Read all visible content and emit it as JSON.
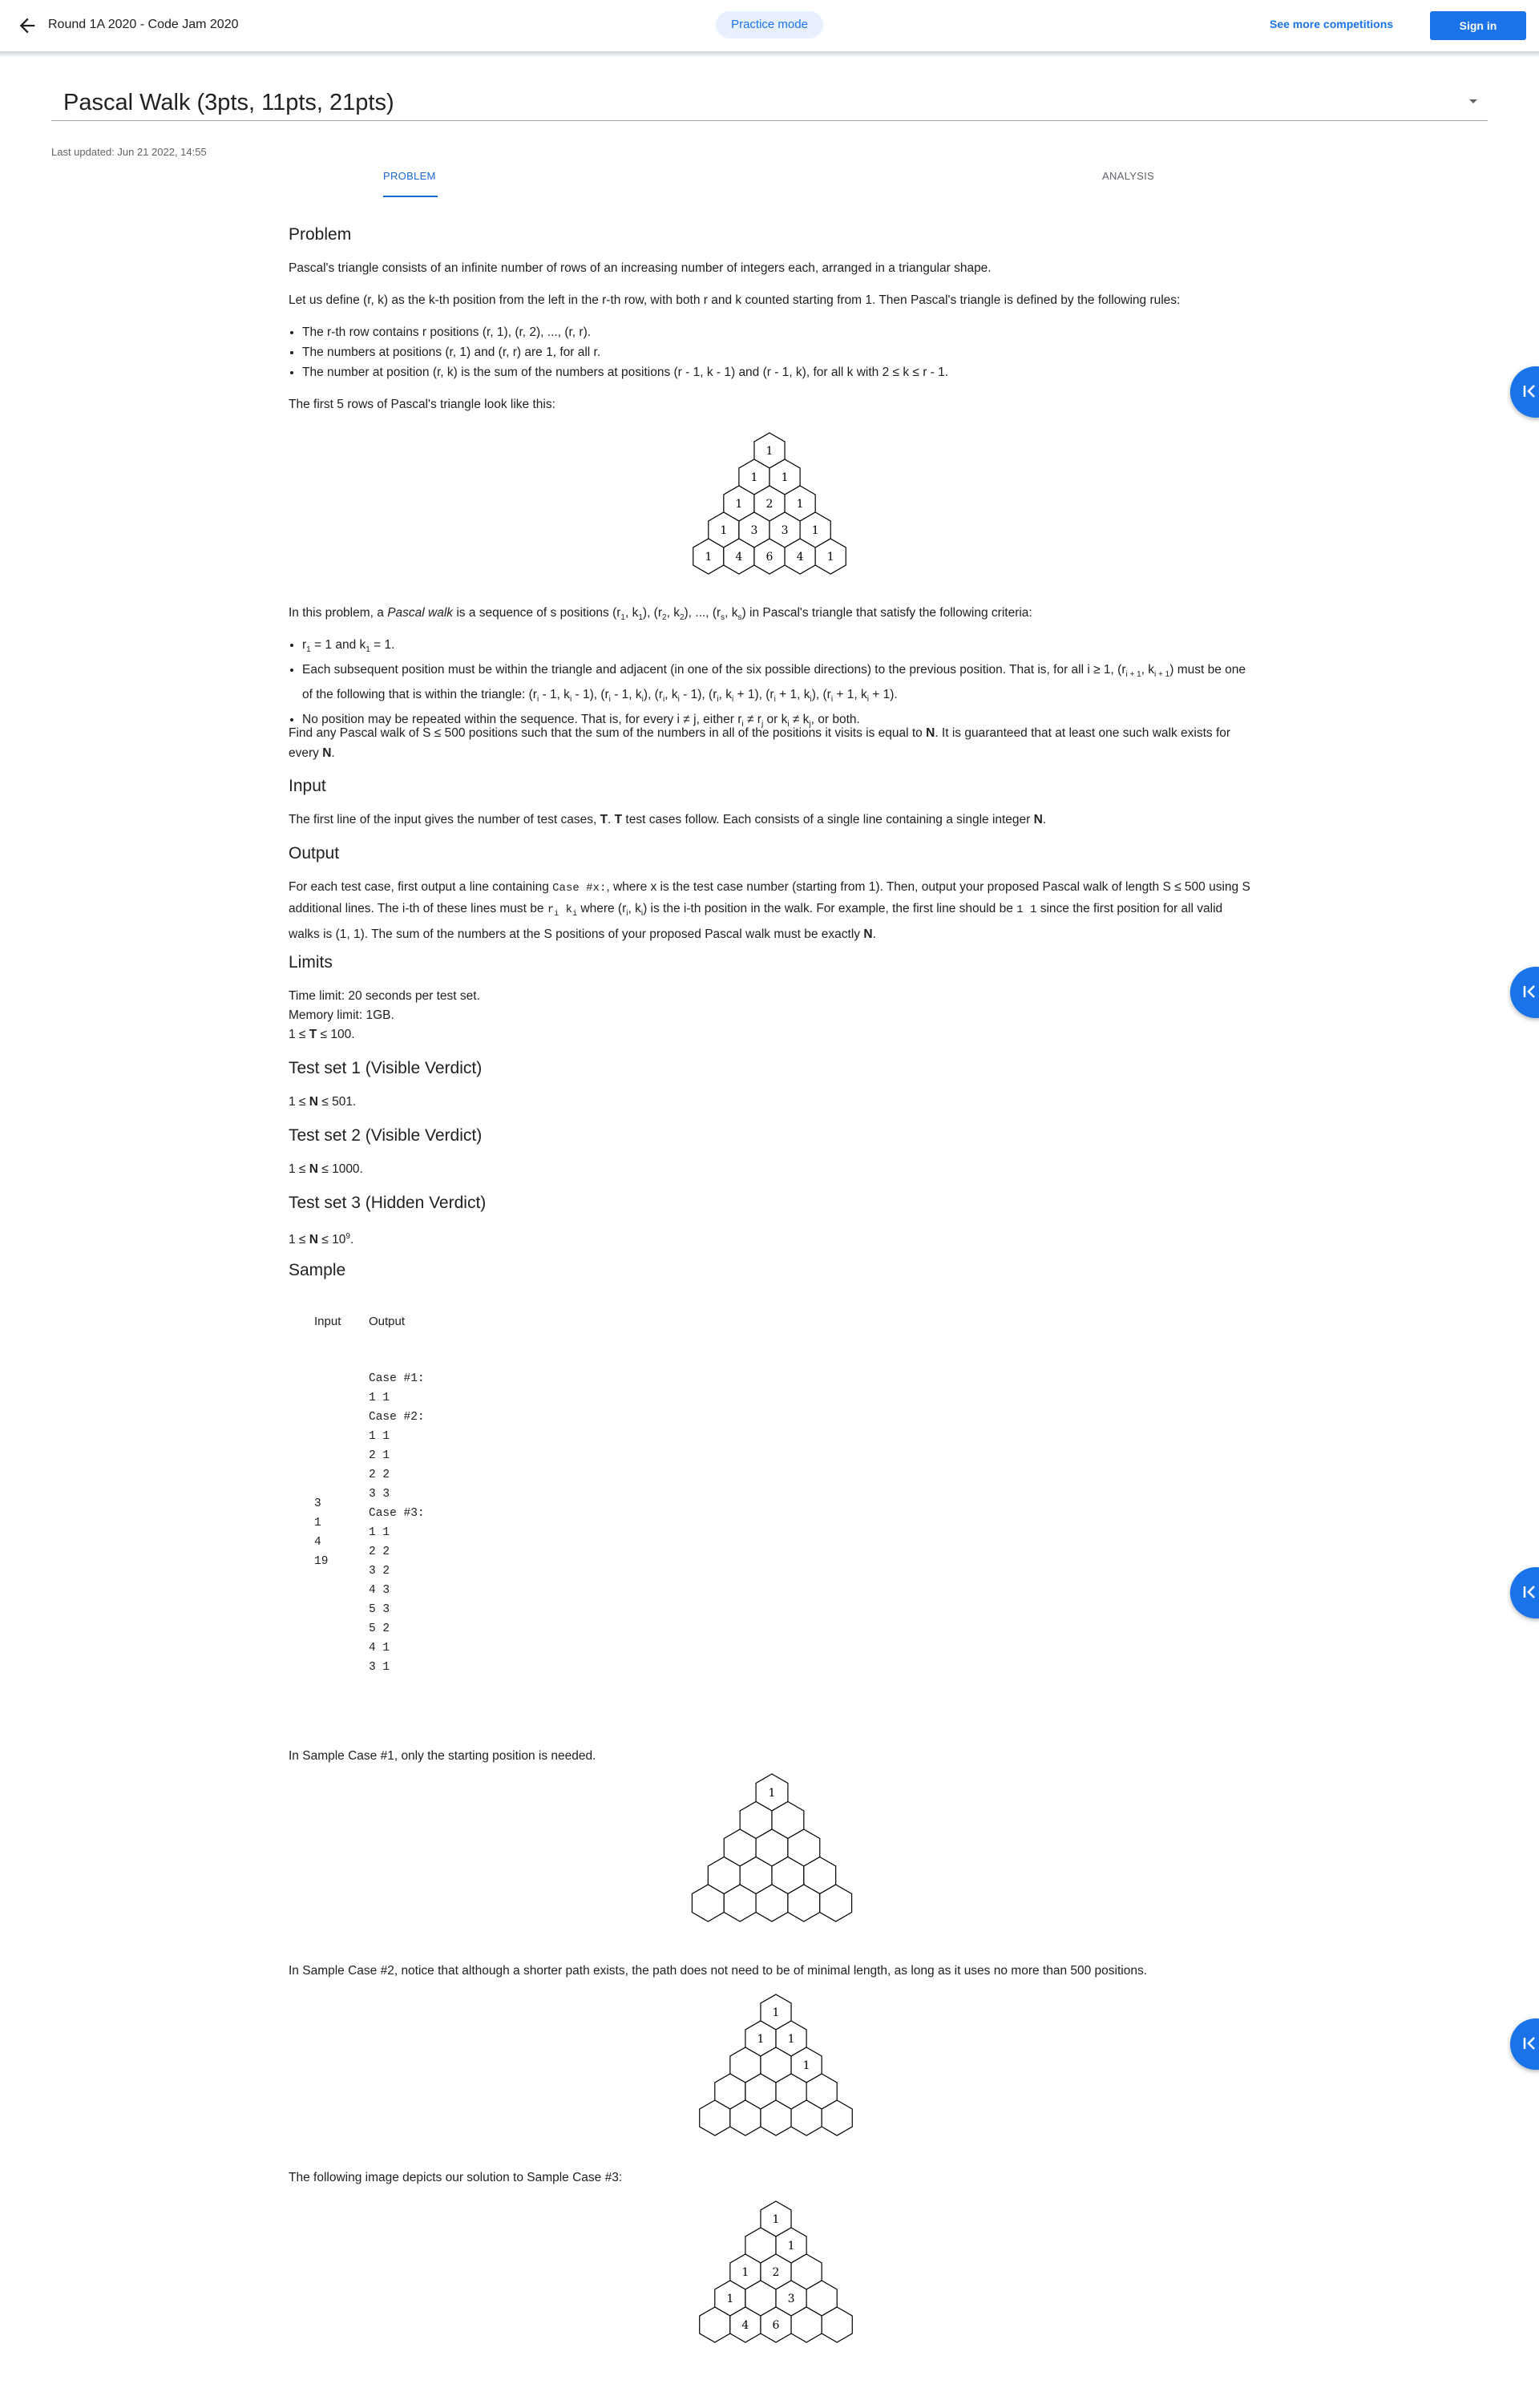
{
  "header": {
    "title": "Round 1A 2020 - Code Jam 2020",
    "mode": "Practice mode",
    "see_more": "See more competitions",
    "sign_in": "Sign in"
  },
  "problem_select": {
    "title": "Pascal Walk (3pts, 11pts, 21pts)"
  },
  "last_updated": "Last updated: Jun 21 2022, 14:55",
  "tabs": {
    "problem": "PROBLEM",
    "analysis": "ANALYSIS"
  },
  "sections": {
    "problem": "Problem",
    "input": "Input",
    "output": "Output",
    "limits": "Limits",
    "ts1": "Test set 1 (Visible Verdict)",
    "ts2": "Test set 2 (Visible Verdict)",
    "ts3": "Test set 3 (Hidden Verdict)",
    "sample": "Sample"
  },
  "text": {
    "p1": "Pascal's triangle consists of an infinite number of rows of an increasing number of integers each, arranged in a triangular shape.",
    "p2": "Let us define (r, k) as the k-th position from the left in the r-th row, with both r and k counted starting from 1. Then Pascal's triangle is defined by the following rules:",
    "rule1": "The r-th row contains r positions (r, 1), (r, 2), ..., (r, r).",
    "rule2": "The numbers at positions (r, 1) and (r, r) are 1, for all r.",
    "rule3": "The number at position (r, k) is the sum of the numbers at positions (r - 1, k - 1) and (r - 1, k), for all k with 2 ≤ k ≤ r - 1.",
    "p3": "The first 5 rows of Pascal's triangle look like this:",
    "walk_intro": "In this problem, a Pascal walk is a sequence of s positions (r1, k1), (r2, k2), ..., (rs, ks) in Pascal's triangle that satisfy the following criteria:",
    "walk1": "r1 = 1 and k1 = 1.",
    "walk2": "Each subsequent position must be within the triangle and adjacent (in one of the six possible directions) to the previous position. That is, for all i ≥ 1, (ri + 1, ki + 1) must be one of the following that is within the triangle: (ri - 1, ki - 1), (ri - 1, ki), (ri, ki - 1), (ri, ki + 1), (ri + 1, ki), (ri + 1, ki + 1).",
    "walk3": "No position may be repeated within the sequence. That is, for every i ≠ j, either ri ≠ rj or ki ≠ kj, or both.",
    "find": "Find any Pascal walk of S ≤ 500 positions such that the sum of the numbers in all of the positions it visits is equal to N. It is guaranteed that at least one such walk exists for every N.",
    "input": "The first line of the input gives the number of test cases, T. T test cases follow. Each consists of a single line containing a single integer N.",
    "output": "For each test case, first output a line containing Case #x:, where x is the test case number (starting from 1). Then, output your proposed Pascal walk of length S ≤ 500 using S additional lines. The i-th of these lines must be ri ki where (ri, ki) is the i-th position in the walk. For example, the first line should be 1 1 since the first position for all valid walks is (1, 1). The sum of the numbers at the S positions of your proposed Pascal walk must be exactly N.",
    "limit1": "Time limit: 20 seconds per test set.",
    "limit2": "Memory limit: 1GB.",
    "limit3": "1 ≤ T ≤ 100.",
    "ts1": "1 ≤ N ≤ 501.",
    "ts2": "1 ≤ N ≤ 1000.",
    "ts3": "1 ≤ N ≤ 10^9.",
    "sample1": "In Sample Case #1, only the starting position is needed.",
    "sample2": "In Sample Case #2, notice that although a shorter path exists, the path does not need to be of minimal length, as long as it uses no more than 500 positions.",
    "sample3": "The following image depicts our solution to Sample Case #3:"
  },
  "sample": {
    "input_header": "Input",
    "output_header": "Output",
    "input": "3\n1\n4\n19",
    "output": "Case #1:\n1 1\nCase #2:\n1 1\n2 1\n2 2\n3 3\nCase #3:\n1 1\n2 2\n3 2\n4 3\n5 3\n5 2\n4 1\n3 1"
  },
  "triangle": {
    "rows": [
      [
        "1"
      ],
      [
        "1",
        "1"
      ],
      [
        "1",
        "2",
        "1"
      ],
      [
        "1",
        "3",
        "3",
        "1"
      ],
      [
        "1",
        "4",
        "6",
        "4",
        "1"
      ]
    ]
  },
  "icons": {
    "back": "arrow-left-icon",
    "dropdown": "caret-down-icon",
    "fab": "collapse-left-icon"
  },
  "colors": {
    "accent": "#1a73e8",
    "pill_bg": "#e8f0fe"
  }
}
